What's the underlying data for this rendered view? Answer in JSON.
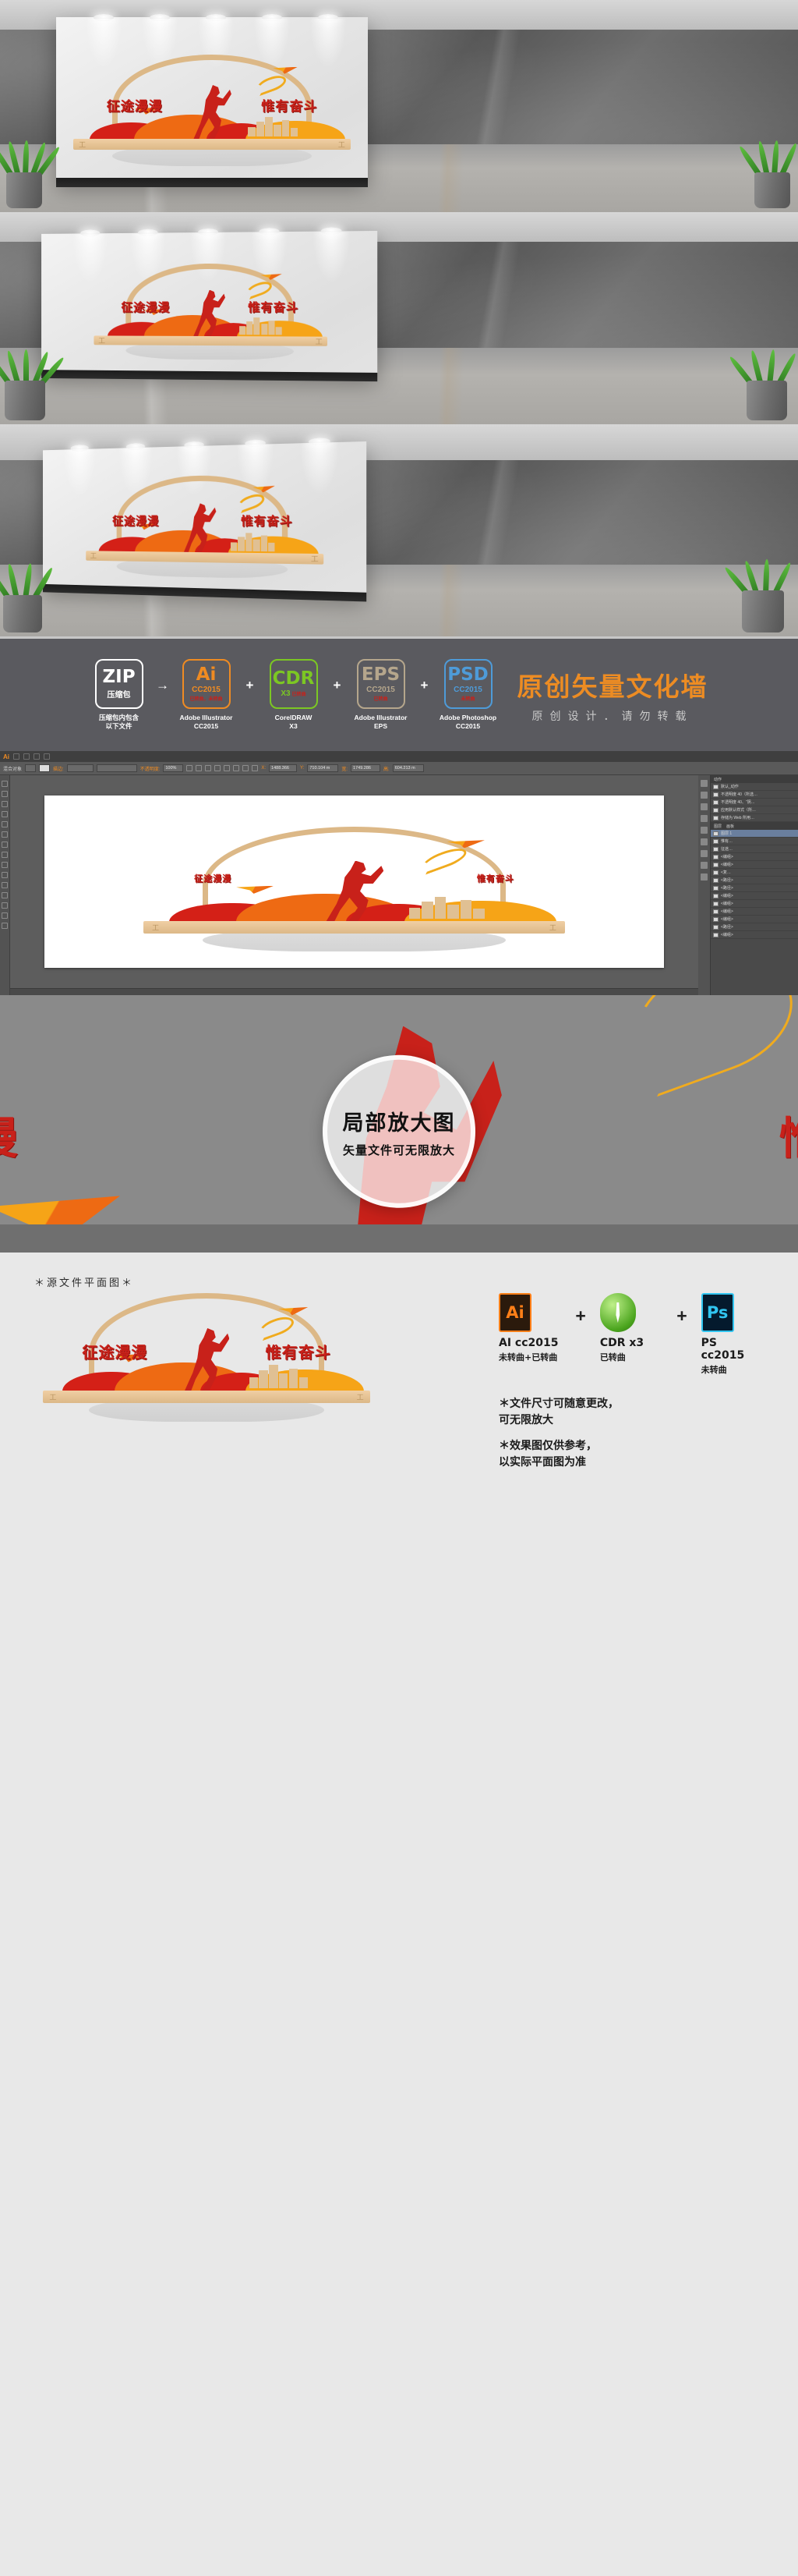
{
  "artwork": {
    "slogan_left": "征途漫漫",
    "slogan_right": "惟有奋斗",
    "colors": {
      "red": "#c8211a",
      "orange": "#ee6a13",
      "yellow": "#f6a417",
      "tan": "#dcb887",
      "deep_red": "#d42017"
    }
  },
  "mockups": [
    {
      "name": "mockup-wide-front"
    },
    {
      "name": "mockup-wide-angled"
    },
    {
      "name": "mockup-perspective"
    }
  ],
  "format_banner": {
    "items": [
      {
        "abbr": "ZIP",
        "version": "压缩包",
        "note": "",
        "caption_line1": "压缩包内包含",
        "caption_line2": "以下文件",
        "color": "#ffffff",
        "separator_after": "→"
      },
      {
        "abbr": "Ai",
        "version": "CC2015",
        "note": "已转曲，未转曲",
        "caption_line1": "Adobe Illustrator",
        "caption_line2": "CC2015",
        "color": "#ef8b22",
        "separator_after": "+"
      },
      {
        "abbr": "CDR",
        "version": "X3",
        "note": "已转曲",
        "caption_line1": "CorelDRAW",
        "caption_line2": "X3",
        "color": "#7cc723",
        "separator_after": "+"
      },
      {
        "abbr": "EPS",
        "version": "CC2015",
        "note": "已转曲",
        "caption_line1": "Adobe Illustrator",
        "caption_line2": "EPS",
        "color": "#b5a68c",
        "separator_after": "+"
      },
      {
        "abbr": "PSD",
        "version": "CC2015",
        "note": "未转曲",
        "caption_line1": "Adobe Photoshop",
        "caption_line2": "CC2015",
        "color": "#4e9bd8",
        "separator_after": ""
      }
    ],
    "title": "原创矢量文化墙",
    "subtitle": "原创设计．请勿转载",
    "title_color": "#ed8c23",
    "background": "#5a5a5f"
  },
  "illustrator": {
    "app_label": "Ai",
    "control_bar": {
      "mixed_object": "混合对象",
      "stroke_label": "描边:",
      "opacity_label": "不透明度:",
      "opacity_value": "100%",
      "x_label": "X:",
      "x_value": "1488.366",
      "y_label": "Y:",
      "y_value": "710.104 m",
      "w_label": "宽:",
      "w_value": "1749.286",
      "h_label": "高:",
      "h_value": "604.213 m"
    },
    "panels": {
      "actions_tab": "动作",
      "action_rows": [
        "默认_动作",
        "不透明度 40（所选…",
        "不透明度 40、“阴…",
        "应用默认样式（所…",
        "存储为 Web 所用…"
      ],
      "layers_tab": "图层",
      "artboards_tab": "画板",
      "layer_rows": [
        "图层 1",
        "惟有…",
        "征途…",
        "<编组>",
        "<编组>",
        "<复…",
        "<路径>",
        "<路径>",
        "<编组>",
        "<编组>",
        "<编组>",
        "<编组>",
        "<路径>",
        "<编组>"
      ]
    }
  },
  "detail_zoom": {
    "title": "局部放大图",
    "subtitle": "矢量文件可无限放大"
  },
  "footer": {
    "source_label": "＊源文件平面图＊",
    "apps": [
      {
        "icon": "ai-app-icon",
        "abbr": "Ai",
        "name": "AI cc2015",
        "note": "未转曲+已转曲"
      },
      {
        "icon": "coreldraw-app-icon",
        "abbr": "",
        "name": "CDR x3",
        "note": "已转曲"
      },
      {
        "icon": "photoshop-app-icon",
        "abbr": "Ps",
        "name": "PS cc2015",
        "note": "未转曲"
      }
    ],
    "plus": "+",
    "notes": [
      "＊文件尺寸可随意更改，\n  可无限放大",
      "＊效果图仅供参考，\n  以实际平面图为准"
    ]
  }
}
